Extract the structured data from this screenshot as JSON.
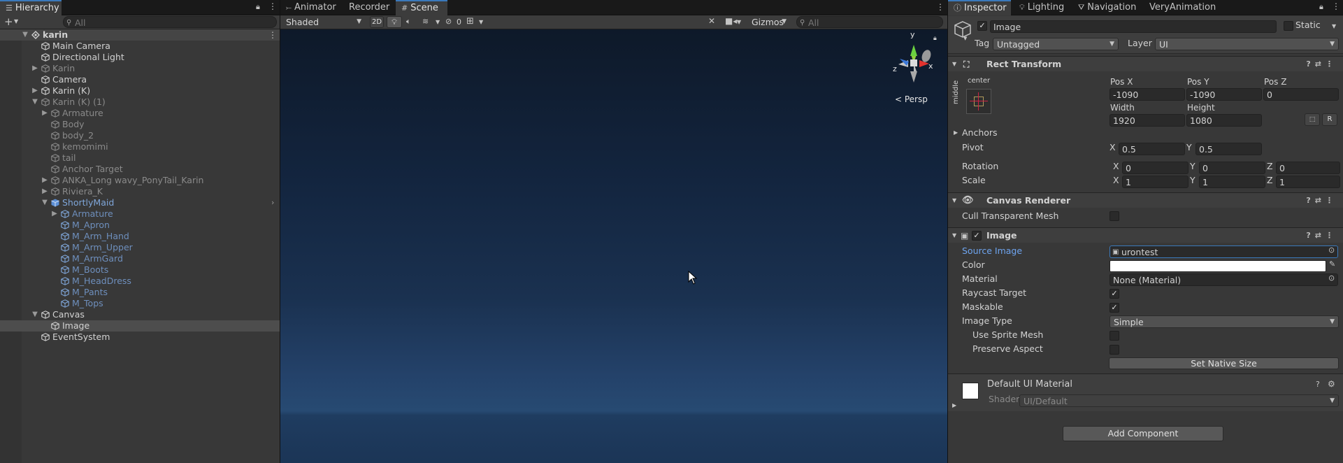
{
  "hierarchy": {
    "tab": "Hierarchy",
    "search_placeholder": "All",
    "rows": [
      {
        "label": "karin",
        "depth": 0,
        "arrow": "down",
        "type": "scene",
        "selected_parent": true
      },
      {
        "label": "Main Camera",
        "depth": 1,
        "arrow": "",
        "type": "go"
      },
      {
        "label": "Directional Light",
        "depth": 1,
        "arrow": "",
        "type": "go"
      },
      {
        "label": "Karin",
        "depth": 1,
        "arrow": "right",
        "type": "go",
        "style": "dim"
      },
      {
        "label": "Camera",
        "depth": 1,
        "arrow": "",
        "type": "go"
      },
      {
        "label": "Karin (K)",
        "depth": 1,
        "arrow": "right",
        "type": "go"
      },
      {
        "label": "Karin (K) (1)",
        "depth": 1,
        "arrow": "down",
        "type": "go",
        "style": "dim"
      },
      {
        "label": "Armature",
        "depth": 2,
        "arrow": "right",
        "type": "go",
        "style": "dim"
      },
      {
        "label": "Body",
        "depth": 2,
        "arrow": "",
        "type": "go",
        "style": "dim"
      },
      {
        "label": "body_2",
        "depth": 2,
        "arrow": "",
        "type": "go",
        "style": "dim"
      },
      {
        "label": "kemomimi",
        "depth": 2,
        "arrow": "",
        "type": "go",
        "style": "dim"
      },
      {
        "label": "tail",
        "depth": 2,
        "arrow": "",
        "type": "go",
        "style": "dim"
      },
      {
        "label": "Anchor Target",
        "depth": 2,
        "arrow": "",
        "type": "go",
        "style": "dim"
      },
      {
        "label": "ANKA_Long wavy_PonyTail_Karin",
        "depth": 2,
        "arrow": "right",
        "type": "go",
        "style": "dim"
      },
      {
        "label": "Riviera_K",
        "depth": 2,
        "arrow": "right",
        "type": "go",
        "style": "dim"
      },
      {
        "label": "ShortlyMaid",
        "depth": 2,
        "arrow": "down",
        "type": "prefab",
        "style": "prefab",
        "more": true
      },
      {
        "label": "Armature",
        "depth": 3,
        "arrow": "right",
        "type": "go",
        "style": "prefabdim"
      },
      {
        "label": "M_Apron",
        "depth": 3,
        "arrow": "",
        "type": "go",
        "style": "prefabdim"
      },
      {
        "label": "M_Arm_Hand",
        "depth": 3,
        "arrow": "",
        "type": "go",
        "style": "prefabdim"
      },
      {
        "label": "M_Arm_Upper",
        "depth": 3,
        "arrow": "",
        "type": "go",
        "style": "prefabdim"
      },
      {
        "label": "M_ArmGard",
        "depth": 3,
        "arrow": "",
        "type": "go",
        "style": "prefabdim"
      },
      {
        "label": "M_Boots",
        "depth": 3,
        "arrow": "",
        "type": "go",
        "style": "prefabdim"
      },
      {
        "label": "M_HeadDress",
        "depth": 3,
        "arrow": "",
        "type": "go",
        "style": "prefabdim"
      },
      {
        "label": "M_Pants",
        "depth": 3,
        "arrow": "",
        "type": "go",
        "style": "prefabdim"
      },
      {
        "label": "M_Tops",
        "depth": 3,
        "arrow": "",
        "type": "go",
        "style": "prefabdim"
      },
      {
        "label": "Canvas",
        "depth": 1,
        "arrow": "down",
        "type": "go"
      },
      {
        "label": "Image",
        "depth": 2,
        "arrow": "",
        "type": "go",
        "selected": true
      },
      {
        "label": "EventSystem",
        "depth": 1,
        "arrow": "",
        "type": "go"
      }
    ]
  },
  "scene": {
    "tabs": [
      "Animator",
      "Recorder",
      "Scene"
    ],
    "active_tab": "Scene",
    "shading_mode": "Shaded",
    "btn_2d": "2D",
    "hidden_count": "0",
    "gizmos_label": "Gizmos",
    "search_placeholder": "All",
    "persp_label": "< Persp",
    "axis_x": "x",
    "axis_y": "y",
    "axis_z": "z"
  },
  "inspector": {
    "tabs": [
      "Inspector",
      "Lighting",
      "Navigation",
      "VeryAnimation"
    ],
    "object_name": "Image",
    "static_label": "Static",
    "tag_label": "Tag",
    "tag_value": "Untagged",
    "layer_label": "Layer",
    "layer_value": "UI",
    "rect_transform": {
      "title": "Rect Transform",
      "anchor_h": "center",
      "anchor_v": "middle",
      "pos_x_label": "Pos X",
      "pos_x": "-1090",
      "pos_y_label": "Pos Y",
      "pos_y": "-1090",
      "pos_z_label": "Pos Z",
      "pos_z": "0",
      "width_label": "Width",
      "width": "1920",
      "height_label": "Height",
      "height": "1080",
      "r_btn": "R",
      "anchors_label": "Anchors",
      "pivot_label": "Pivot",
      "pivot_x": "0.5",
      "pivot_y": "0.5",
      "rotation_label": "Rotation",
      "rot_x": "0",
      "rot_y": "0",
      "rot_z": "0",
      "scale_label": "Scale",
      "scale_x": "1",
      "scale_y": "1",
      "scale_z": "1",
      "x": "X",
      "y": "Y",
      "z": "Z"
    },
    "canvas_renderer": {
      "title": "Canvas Renderer",
      "cull_label": "Cull Transparent Mesh"
    },
    "image": {
      "title": "Image",
      "source_image_label": "Source Image",
      "source_image_value": "urontest",
      "color_label": "Color",
      "material_label": "Material",
      "material_value": "None (Material)",
      "raycast_label": "Raycast Target",
      "maskable_label": "Maskable",
      "image_type_label": "Image Type",
      "image_type_value": "Simple",
      "use_sprite_mesh_label": "Use Sprite Mesh",
      "preserve_aspect_label": "Preserve Aspect",
      "set_native_size": "Set Native Size"
    },
    "material_preview": {
      "title": "Default UI Material",
      "shader_label": "Shader",
      "shader_value": "UI/Default"
    },
    "add_component": "Add Component"
  },
  "colors": {
    "accent": "#3a79bb",
    "selection": "#2c5d87",
    "prefab_text": "#7fa6d9",
    "link_label": "#6ea4ef"
  }
}
